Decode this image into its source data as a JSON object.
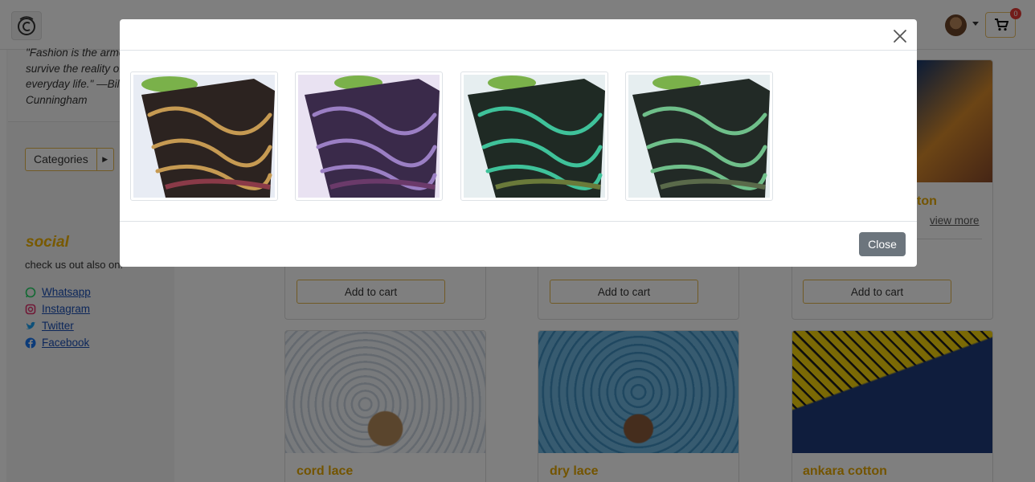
{
  "header": {
    "logo_icon": "brand-logo-icon",
    "cart_count": "0"
  },
  "sidebar": {
    "quote": "\"Fashion is the armour to survive the reality of everyday life.\" —Bill Cunningham",
    "categories_label": "Categories",
    "social_title": "social",
    "social_subtitle": "check us out also on:",
    "social_links": [
      {
        "label": "Whatsapp",
        "icon": "whatsapp-icon",
        "color": "#25d366"
      },
      {
        "label": "Instagram",
        "icon": "instagram-icon",
        "color": "#e1306c"
      },
      {
        "label": "Twitter",
        "icon": "twitter-icon",
        "color": "#1da1f2"
      },
      {
        "label": "Facebook",
        "icon": "facebook-icon",
        "color": "#1877f2"
      }
    ]
  },
  "products": {
    "add_to_cart_label": "Add to cart",
    "view_more_label": "view more",
    "top_right_title_fragment": "ton",
    "bottom_row": [
      {
        "title": "cord lace",
        "color": "#dfe6ef"
      },
      {
        "title": "dry lace",
        "color": "#5fa8d6"
      },
      {
        "title": "ankara cotton",
        "color": "#f4d20a"
      }
    ]
  },
  "modal": {
    "close_label": "Close",
    "images": [
      {
        "name": "lace-brown-gold",
        "base": "#2c2320",
        "pattern": "#c69a52",
        "accent": "#8a3a48"
      },
      {
        "name": "lace-purple",
        "base": "#3a2a4a",
        "pattern": "#9b7fc4",
        "accent": "#6b3a6a"
      },
      {
        "name": "lace-green-teal",
        "base": "#1f2a24",
        "pattern": "#3fc29a",
        "accent": "#6a7a3a"
      },
      {
        "name": "lace-green-gray",
        "base": "#222a26",
        "pattern": "#6fbf8a",
        "accent": "#5a6a4a"
      }
    ]
  },
  "colors": {
    "accent": "#f0b300",
    "overlay": "rgba(0,0,0,0.5)",
    "close_button": "#6c757d"
  }
}
